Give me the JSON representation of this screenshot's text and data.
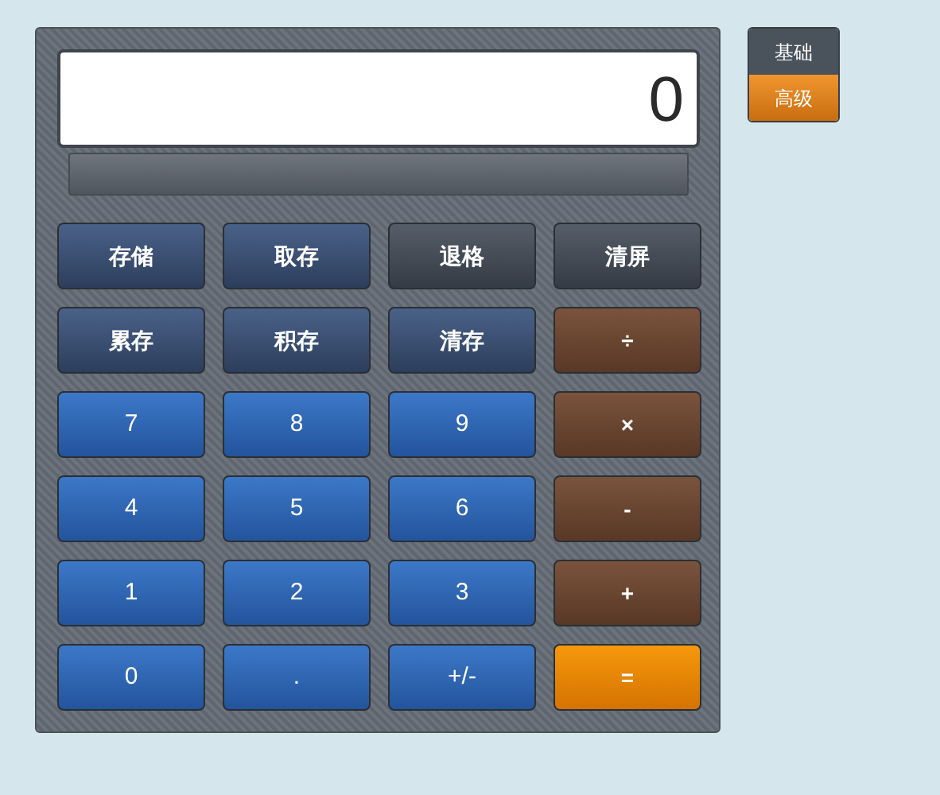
{
  "display": {
    "value": "0"
  },
  "modes": [
    {
      "label": "基础",
      "selected": false
    },
    {
      "label": "高级",
      "selected": true
    }
  ],
  "keys": [
    {
      "label": "存储",
      "kind": "memory"
    },
    {
      "label": "取存",
      "kind": "memory"
    },
    {
      "label": "退格",
      "kind": "function"
    },
    {
      "label": "清屏",
      "kind": "function"
    },
    {
      "label": "累存",
      "kind": "memory"
    },
    {
      "label": "积存",
      "kind": "memory"
    },
    {
      "label": "清存",
      "kind": "memory"
    },
    {
      "label": "÷",
      "kind": "operator"
    },
    {
      "label": "7",
      "kind": "digit"
    },
    {
      "label": "8",
      "kind": "digit"
    },
    {
      "label": "9",
      "kind": "digit"
    },
    {
      "label": "×",
      "kind": "operator"
    },
    {
      "label": "4",
      "kind": "digit"
    },
    {
      "label": "5",
      "kind": "digit"
    },
    {
      "label": "6",
      "kind": "digit"
    },
    {
      "label": "-",
      "kind": "operator"
    },
    {
      "label": "1",
      "kind": "digit"
    },
    {
      "label": "2",
      "kind": "digit"
    },
    {
      "label": "3",
      "kind": "digit"
    },
    {
      "label": "+",
      "kind": "operator"
    },
    {
      "label": "0",
      "kind": "digit"
    },
    {
      "label": ".",
      "kind": "digit"
    },
    {
      "label": "+/-",
      "kind": "digit"
    },
    {
      "label": "=",
      "kind": "equals"
    }
  ]
}
